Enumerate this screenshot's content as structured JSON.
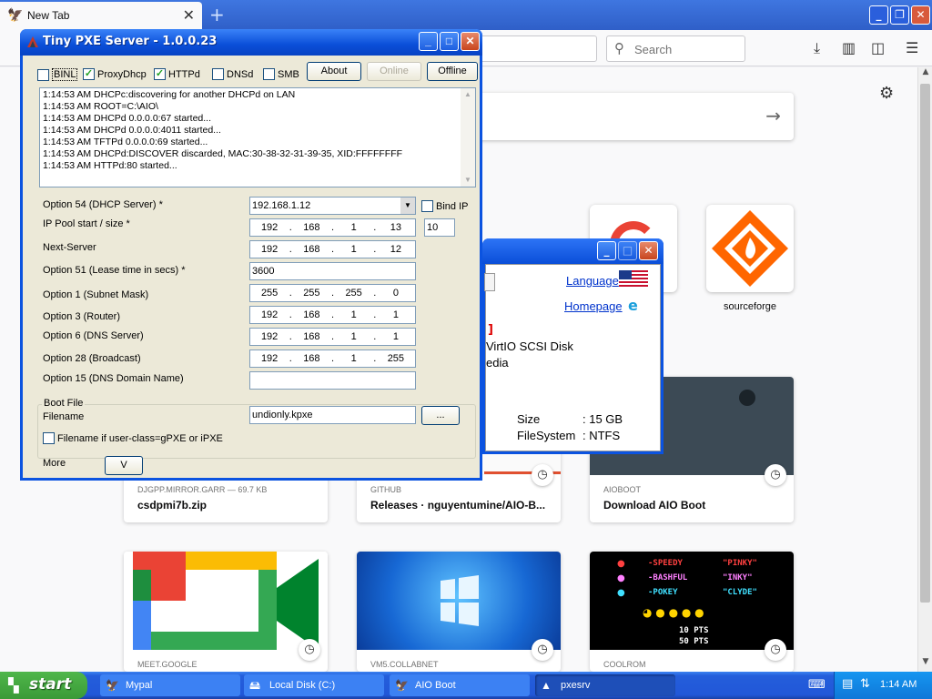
{
  "browser": {
    "tab_title": "New Tab",
    "search_placeholder": "Search"
  },
  "topsites": [
    {
      "label": "sourceforge"
    }
  ],
  "highlights_row1": [
    {
      "host": "DJGPP.MIRROR.GARR — 69.7 KB",
      "title": "csdpmi7b.zip"
    },
    {
      "host": "GITHUB",
      "title": "Releases · nguyentumine/AIO-B..."
    },
    {
      "host": "AIOBOOT",
      "title": "Download AIO Boot"
    }
  ],
  "highlights_row2": [
    {
      "host": "MEET.GOOGLE",
      "title": ""
    },
    {
      "host": "VM5.COLLABNET",
      "title": ""
    },
    {
      "host": "COOLROM",
      "title": ""
    }
  ],
  "pacman": [
    {
      "left": "-SPEEDY",
      "right": "\"PINKY\"",
      "color": "#ff4040"
    },
    {
      "left": "-BASHFUL",
      "right": "\"INKY\"",
      "color": "#ff80ff"
    },
    {
      "left": "-POKEY",
      "right": "\"CLYDE\"",
      "color": "#40e0ff"
    }
  ],
  "pacman_points": [
    "10 PTS",
    "50 PTS"
  ],
  "win2": {
    "language_link": "Language",
    "homepage_link": "Homepage",
    "bracket": "]",
    "disk_line": "VirtIO SCSI Disk",
    "media_line": "edia",
    "size_label": "Size",
    "size_value": ": 15 GB",
    "fs_label": "FileSystem",
    "fs_value": ": NTFS"
  },
  "pxe": {
    "title": "Tiny PXE Server - 1.0.0.23",
    "checks": [
      {
        "label": "BINL",
        "checked": false
      },
      {
        "label": "ProxyDhcp",
        "checked": true
      },
      {
        "label": "HTTPd",
        "checked": true
      },
      {
        "label": "DNSd",
        "checked": false
      },
      {
        "label": "SMB",
        "checked": false
      }
    ],
    "btn_about": "About",
    "btn_online": "Online",
    "btn_offline": "Offline",
    "log": [
      "1:14:53 AM DHCPc:discovering for another DHCPd on LAN",
      "1:14:53 AM ROOT=C:\\AIO\\",
      "1:14:53 AM DHCPd 0.0.0.0:67 started...",
      "1:14:53 AM DHCPd 0.0.0.0:4011 started...",
      "1:14:53 AM TFTPd 0.0.0.0:69 started...",
      "1:14:53 AM DHCPd:DISCOVER discarded, MAC:30-38-32-31-39-35, XID:FFFFFFFF",
      "1:14:53 AM HTTPd:80 started..."
    ],
    "opt54_label": "Option 54 (DHCP Server) *",
    "opt54_value": "192.168.1.12",
    "bind_ip": "Bind IP",
    "pool_label": "IP Pool start / size *",
    "pool_ip": [
      "192",
      "168",
      "1",
      "13"
    ],
    "pool_size": "10",
    "next_label": "Next-Server",
    "next_ip": [
      "192",
      "168",
      "1",
      "12"
    ],
    "opt51_label": "Option 51 (Lease time in secs) *",
    "opt51_value": "3600",
    "opt1_label": "Option 1  (Subnet Mask)",
    "opt1_ip": [
      "255",
      "255",
      "255",
      "0"
    ],
    "opt3_label": "Option 3  (Router)",
    "opt3_ip": [
      "192",
      "168",
      "1",
      "1"
    ],
    "opt6_label": "Option 6  (DNS Server)",
    "opt6_ip": [
      "192",
      "168",
      "1",
      "1"
    ],
    "opt28_label": "Option 28 (Broadcast)",
    "opt28_ip": [
      "192",
      "168",
      "1",
      "255"
    ],
    "opt15_label": "Option 15 (DNS Domain Name)",
    "opt15_value": "",
    "bootfile_group": "Boot File",
    "filename_label": "Filename",
    "filename_value": "undionly.kpxe",
    "browse": "...",
    "ifuser_label": "Filename if user-class=gPXE or iPXE",
    "more_label": "More",
    "more_btn": "V"
  },
  "taskbar": {
    "start": "start",
    "tasks": [
      {
        "label": "Mypal",
        "icon": "mypal-icon",
        "active": false
      },
      {
        "label": "Local Disk (C:)",
        "icon": "drive-icon",
        "active": false
      },
      {
        "label": "AIO Boot",
        "icon": "aioboot-icon",
        "active": false
      },
      {
        "label": "pxesrv",
        "icon": "pxesrv-icon",
        "active": true
      }
    ],
    "clock": "1:14 AM"
  }
}
